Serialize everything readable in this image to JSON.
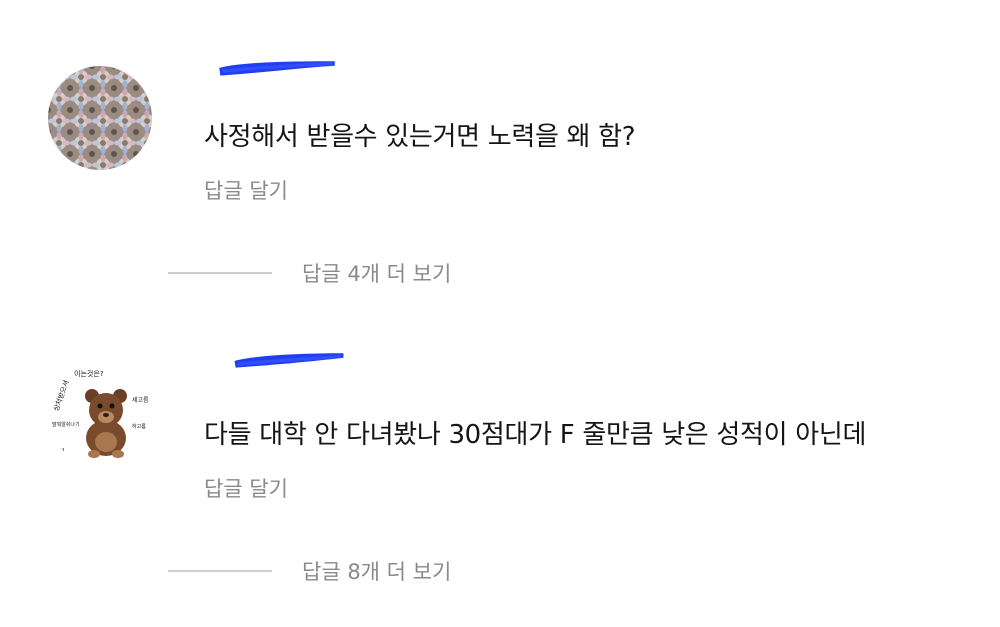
{
  "comments": [
    {
      "author": "",
      "text": "사정해서 받을수 있는거면 노력을 왜 함?",
      "reply_label": "답글 달기",
      "more_replies": "답글 4개 더 보기"
    },
    {
      "author": "",
      "text": "다들 대학 안 다녀봤나 30점대가 F 줄만큼 낮은 성적이 아닌데",
      "reply_label": "답글 달기",
      "more_replies": "답글 8개 더 보기",
      "avatar_text": [
        "이는것은?",
        "상처받으셔",
        "세고름",
        "말뭐알쉬나기",
        "하고름",
        "캐"
      ]
    }
  ],
  "colors": {
    "redaction": "#1f3ff0",
    "secondary_text": "#8a8a8a",
    "divider": "#cfcfcf"
  }
}
